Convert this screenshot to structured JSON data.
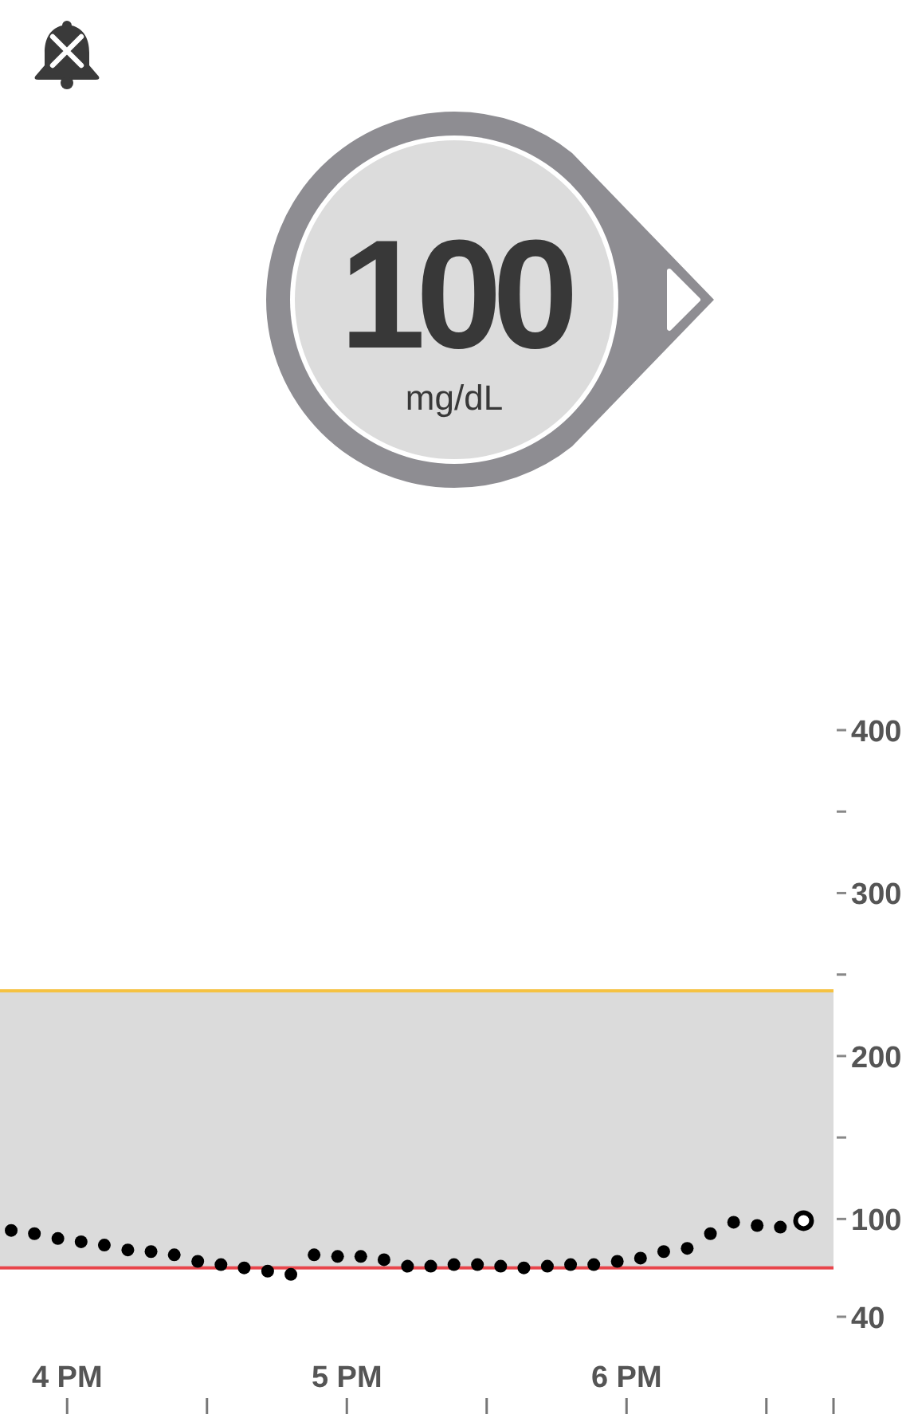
{
  "alert_muted": true,
  "reading": {
    "value": "100",
    "unit": "mg/dL",
    "kind": "steady"
  },
  "graph": {
    "chart_data": {
      "type": "scatter",
      "x": [
        3.8,
        3.883,
        3.967,
        4.05,
        4.133,
        4.217,
        4.3,
        4.383,
        4.467,
        4.55,
        4.633,
        4.717,
        4.8,
        4.883,
        4.967,
        5.05,
        5.133,
        5.217,
        5.3,
        5.383,
        5.467,
        5.55,
        5.633,
        5.717,
        5.8,
        5.883,
        5.967,
        6.05,
        6.133,
        6.217,
        6.3,
        6.383,
        6.467,
        6.55,
        6.633
      ],
      "series": [
        {
          "color": "#000000",
          "values": [
            93,
            91,
            88,
            86,
            84,
            81,
            80,
            78,
            74,
            72,
            70,
            68,
            66,
            78,
            77,
            77,
            75,
            71,
            71,
            72,
            72,
            71,
            70,
            71,
            72,
            72,
            74,
            76,
            80,
            82,
            91,
            98,
            96,
            95,
            99
          ]
        }
      ],
      "xlim": [
        3.76,
        6.74
      ],
      "ylim": [
        40,
        400
      ],
      "xticks": [
        {
          "value": 4,
          "label": "4 PM"
        },
        {
          "value": 5,
          "label": "5 PM"
        },
        {
          "value": 6,
          "label": "6 PM"
        }
      ],
      "yticks": [
        400,
        300,
        200,
        100,
        40
      ],
      "bands": [
        {
          "axis": "y",
          "from": 70,
          "to": 240,
          "color": "#dbdbdb"
        }
      ],
      "ref_lines": [
        {
          "axis": "y",
          "value": 240,
          "color": "#f5c242"
        },
        {
          "axis": "y",
          "value": 70,
          "color": "#e8454b"
        }
      ]
    }
  }
}
